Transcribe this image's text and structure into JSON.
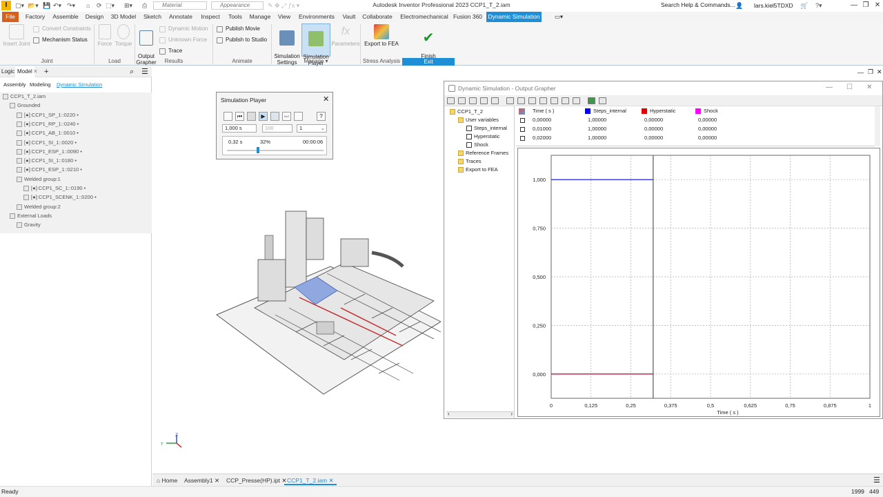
{
  "titlebar": {
    "app_letter": "I",
    "material": "Material",
    "appearance": "Appearance",
    "title": "Autodesk Inventor Professional 2023   CCP1_T_2.iam",
    "search": "Search Help & Commands...",
    "user": "lars.kiel5TDXD"
  },
  "tabs": [
    "File",
    "Factory",
    "Assemble",
    "Design",
    "3D Model",
    "Sketch",
    "Annotate",
    "Inspect",
    "Tools",
    "Manage",
    "View",
    "Environments",
    "Vault",
    "Collaborate",
    "Electromechanical",
    "Fusion 360",
    "Dynamic Simulation"
  ],
  "ribbon": {
    "joint": {
      "insert_joint": "Insert Joint",
      "convert_constraints": "Convert Constraints",
      "mechanism_status": "Mechanism Status",
      "label": "Joint"
    },
    "load": {
      "force": "Force",
      "torque": "Torque",
      "label": "Load"
    },
    "results": {
      "output_grapher": "Output\nGrapher",
      "dynamic_motion": "Dynamic Motion",
      "unknown_force": "Unknown Force",
      "trace": "Trace",
      "label": "Results"
    },
    "animate": {
      "publish_movie": "Publish Movie",
      "publish_studio": "Publish to Studio",
      "label": "Animate"
    },
    "manage": {
      "sim_settings": "Simulation\nSettings",
      "sim_player": "Simulation\nPlayer",
      "parameters": "Parameters",
      "label": "Manage ▾"
    },
    "stress": {
      "export_fea": "Export to FEA",
      "label": "Stress Analysis"
    },
    "exit": {
      "finish": "Finish\nDynamic Simulation",
      "label": "Exit"
    }
  },
  "browser": {
    "tabs": [
      "Logic",
      "Model",
      "+"
    ],
    "subtabs": [
      "Assembly",
      "Modeling",
      "Dynamic Simulation"
    ],
    "tree": [
      {
        "label": "CCP1_T_2.iam",
        "indent": 0
      },
      {
        "label": "Grounded",
        "indent": 1
      },
      {
        "label": "[●]:CCP1_SP_1::0220 •",
        "indent": 2
      },
      {
        "label": "[●]:CCP1_RP_1::0240 •",
        "indent": 2
      },
      {
        "label": "[●]:CCP1_AB_1::0010 •",
        "indent": 2
      },
      {
        "label": "[●]:CCP1_SI_1::0020 •",
        "indent": 2
      },
      {
        "label": "[●]:CCP1_ESP_1::0090 •",
        "indent": 2
      },
      {
        "label": "[●]:CCP1_SI_1::0180 •",
        "indent": 2
      },
      {
        "label": "[●]:CCP1_ESP_1::0210 •",
        "indent": 2
      },
      {
        "label": "Welded group:1",
        "indent": 2
      },
      {
        "label": "[●]:CCP1_SC_1::0190 •",
        "indent": 3
      },
      {
        "label": "[●]:CCP1_SCENK_1::0200 •",
        "indent": 3
      },
      {
        "label": "Welded group:2",
        "indent": 2
      },
      {
        "label": "External Loads",
        "indent": 1
      },
      {
        "label": "Gravity",
        "indent": 2
      }
    ]
  },
  "sim_player": {
    "title": "Simulation Player",
    "end_time": "1,000 s",
    "images": "100",
    "filter": "1",
    "current_time": "0,32 s",
    "percent": "32%",
    "elapsed": "00:00:06",
    "progress": 0.32
  },
  "grapher": {
    "title": "Dynamic Simulation - Output Grapher",
    "tree": [
      "CCP1_T_2",
      "User variables",
      "Steps_internal",
      "Hyperstatic",
      "Shock",
      "Reference Frames",
      "Traces",
      "Export to FEA"
    ],
    "table": {
      "headers": [
        "Time ( s )",
        "Steps_internal",
        "Hyperstatic",
        "Shock"
      ],
      "colors": [
        "#0000ff",
        "#e00000",
        "#ff00ff"
      ],
      "rows": [
        [
          "0,00000",
          "1,00000",
          "0,00000",
          "0,00000"
        ],
        [
          "0,01000",
          "1,00000",
          "0,00000",
          "0,00000"
        ],
        [
          "0,02000",
          "1,00000",
          "0,00000",
          "0,00000"
        ]
      ]
    }
  },
  "chart_data": {
    "type": "line",
    "xlabel": "Time ( s )",
    "ylabel": "",
    "xlim": [
      0,
      1
    ],
    "ylim": [
      -0.125,
      1.125
    ],
    "x_ticks": [
      "0",
      "0,125",
      "0,25",
      "0,375",
      "0,5",
      "0,625",
      "0,75",
      "0,875",
      "1"
    ],
    "y_ticks": [
      "1,000",
      "0,750",
      "0,500",
      "0,250",
      "0,000"
    ],
    "y_tick_values": [
      1.0,
      0.75,
      0.5,
      0.25,
      0.0
    ],
    "current_time": 0.32,
    "series": [
      {
        "name": "Steps_internal",
        "color": "#0000ff",
        "x": [
          0,
          0.32
        ],
        "y": [
          1.0,
          1.0
        ]
      },
      {
        "name": "Hyperstatic",
        "color": "#e00000",
        "x": [
          0,
          0.32
        ],
        "y": [
          0.0,
          0.0
        ]
      },
      {
        "name": "Shock",
        "color": "#ff00ff",
        "x": [
          0,
          0.32
        ],
        "y": [
          0.0,
          0.0
        ]
      }
    ]
  },
  "doc_tabs": [
    "Home",
    "Assembly1",
    "CCP_Presse(HP).ipt",
    "CCP1_T_2.iam"
  ],
  "status": {
    "left": "Ready",
    "num1": "1999",
    "num2": "449"
  }
}
